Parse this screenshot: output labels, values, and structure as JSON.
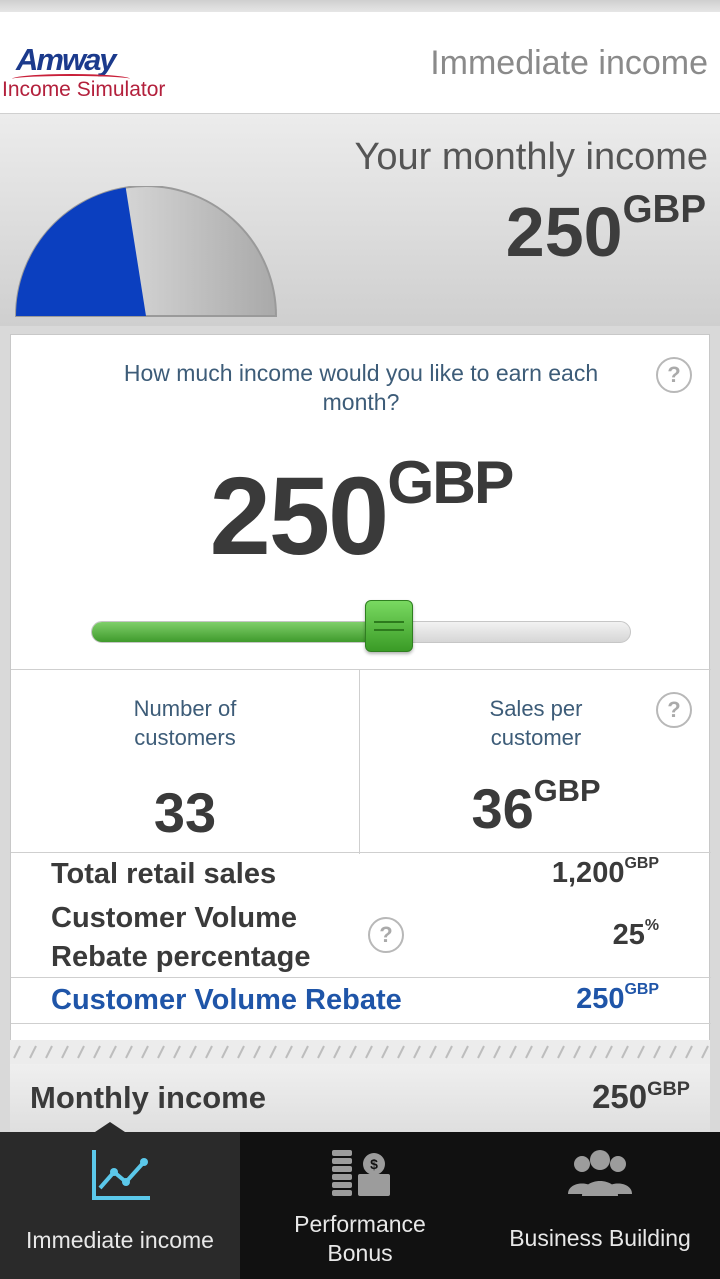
{
  "header": {
    "logo_brand": "Amway",
    "logo_subtitle": "Income Simulator",
    "title": "Immediate income"
  },
  "summary": {
    "label": "Your monthly income",
    "value": "250",
    "currency": "GBP",
    "gauge_fill_fraction": 0.45,
    "gauge_fill_color": "#0b3fbf"
  },
  "question": {
    "text": "How much income would you like to earn each month?",
    "help_symbol": "?"
  },
  "income_input": {
    "value": "250",
    "currency": "GBP"
  },
  "slider": {
    "fill_fraction": 0.55,
    "color": "#4cae36"
  },
  "customers": {
    "label": "Number of customers",
    "value": "33"
  },
  "sales": {
    "label": "Sales per customer",
    "value": "36",
    "currency": "GBP",
    "help_symbol": "?"
  },
  "breakdown": {
    "total_retail_label": "Total retail sales",
    "total_retail_value": "1,200",
    "total_retail_currency": "GBP",
    "cvr_percent_label_1": "Customer Volume",
    "cvr_percent_label_2": "Rebate percentage",
    "cvr_percent_value": "25",
    "cvr_percent_unit": "%",
    "cvr_help_symbol": "?",
    "cvr_label": "Customer Volume Rebate",
    "cvr_value": "250",
    "cvr_currency": "GBP"
  },
  "monthly": {
    "label": "Monthly income",
    "value": "250",
    "currency": "GBP"
  },
  "tabs": [
    {
      "label": "Immediate income",
      "icon": "chart-line-icon"
    },
    {
      "label_1": "Performance",
      "label_2": "Bonus",
      "icon": "coins-icon"
    },
    {
      "label": "Business Building",
      "icon": "people-icon"
    }
  ],
  "colors": {
    "accent_blue": "#1f55a8",
    "brand_red": "#b3203c",
    "tab_icon": "#5bc8ea"
  }
}
